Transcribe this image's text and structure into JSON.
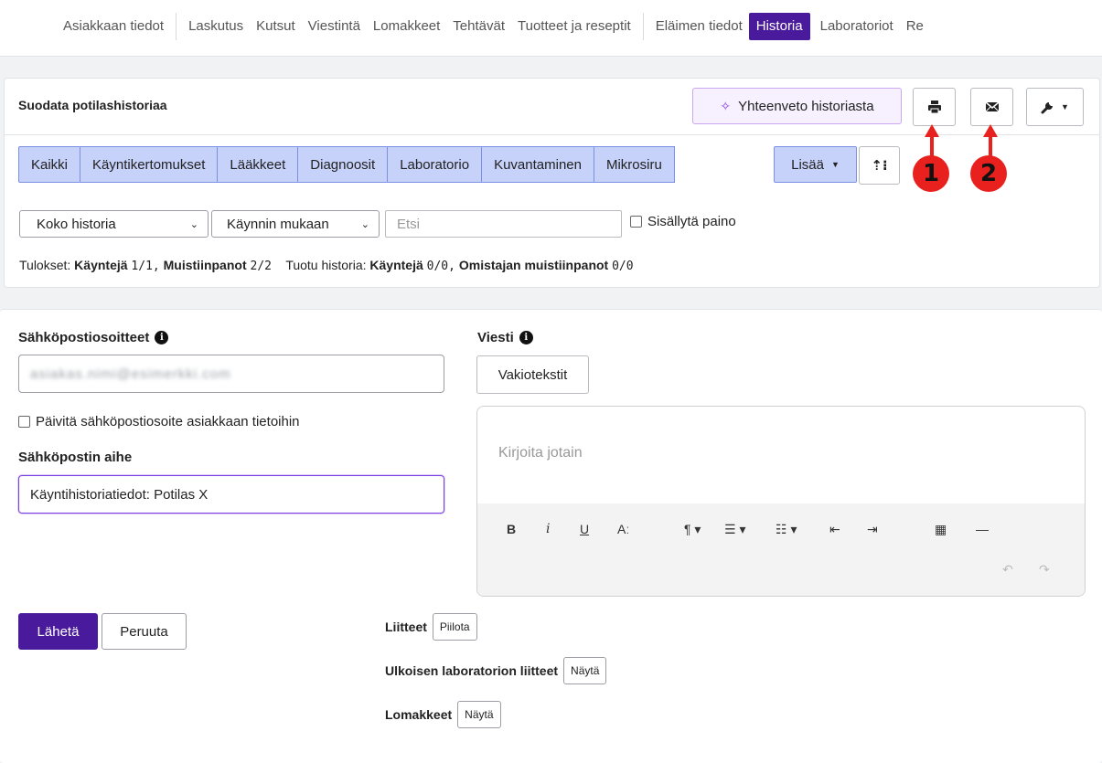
{
  "nav": {
    "tabs": [
      "Asiakkaan tiedot",
      "Laskutus",
      "Kutsut",
      "Viestintä",
      "Lomakkeet",
      "Tehtävät",
      "Tuotteet ja reseptit",
      "Eläimen tiedot",
      "Historia",
      "Laboratoriot",
      "Re"
    ],
    "active": "Historia"
  },
  "filter": {
    "title": "Suodata potilashistoriaa",
    "summary_button": "Yhteenveto historiasta",
    "print_icon": "printer-icon",
    "email_icon": "envelope-icon",
    "tools_icon": "wrench-icon",
    "segments": [
      "Kaikki",
      "Käyntikertomukset",
      "Lääkkeet",
      "Diagnoosit",
      "Laboratorio",
      "Kuvantaminen",
      "Mikrosiru"
    ],
    "more_label": "Lisää",
    "range_select": "Koko historia",
    "order_select": "Käynnin mukaan",
    "search_placeholder": "Etsi",
    "include_weight_label": "Sisällytä paino",
    "results": {
      "prefix": "Tulokset:",
      "visits_label": "Käyntejä",
      "visits_value": "1/1,",
      "notes_label": "Muistiinpanot",
      "notes_value": "2/2",
      "imported_prefix": "Tuotu historia:",
      "imported_visits_label": "Käyntejä",
      "imported_visits_value": "0/0,",
      "owner_notes_label": "Omistajan muistiinpanot",
      "owner_notes_value": "0/0"
    }
  },
  "email": {
    "addresses_label": "Sähköpostiosoitteet",
    "address_value": "asiakas.nimi@esimerkki.com",
    "update_address_label": "Päivitä sähköpostiosoite asiakkaan tietoihin",
    "subject_label": "Sähköpostin aihe",
    "subject_value": "Käyntihistoriatiedot: Potilas X",
    "message_label": "Viesti",
    "templates_button": "Vakiotekstit",
    "editor_placeholder": "Kirjoita jotain",
    "toolbar": {
      "bold": "B",
      "italic": "i",
      "underline": "U",
      "font_size": "Aː",
      "paragraph": "¶ ▾",
      "ordered_list": "☰ ▾",
      "bullet_list": "☷ ▾",
      "outdent": "⇤",
      "indent": "⇥",
      "table": "▦",
      "hr": "—",
      "undo": "↶",
      "redo": "↷"
    },
    "send_button": "Lähetä",
    "cancel_button": "Peruuta",
    "attachments_label": "Liitteet",
    "attachments_button": "Piilota",
    "external_lab_label": "Ulkoisen laboratorion liitteet",
    "external_lab_button": "Näytä",
    "forms_label": "Lomakkeet",
    "forms_button": "Näytä"
  },
  "annotations": {
    "marker_1": "1",
    "marker_2": "2",
    "color": "#e8201e"
  },
  "colors": {
    "accent": "#4a1a9c",
    "segment_bg": "#c7d2fb",
    "summary_bg": "#f6f0ff"
  }
}
